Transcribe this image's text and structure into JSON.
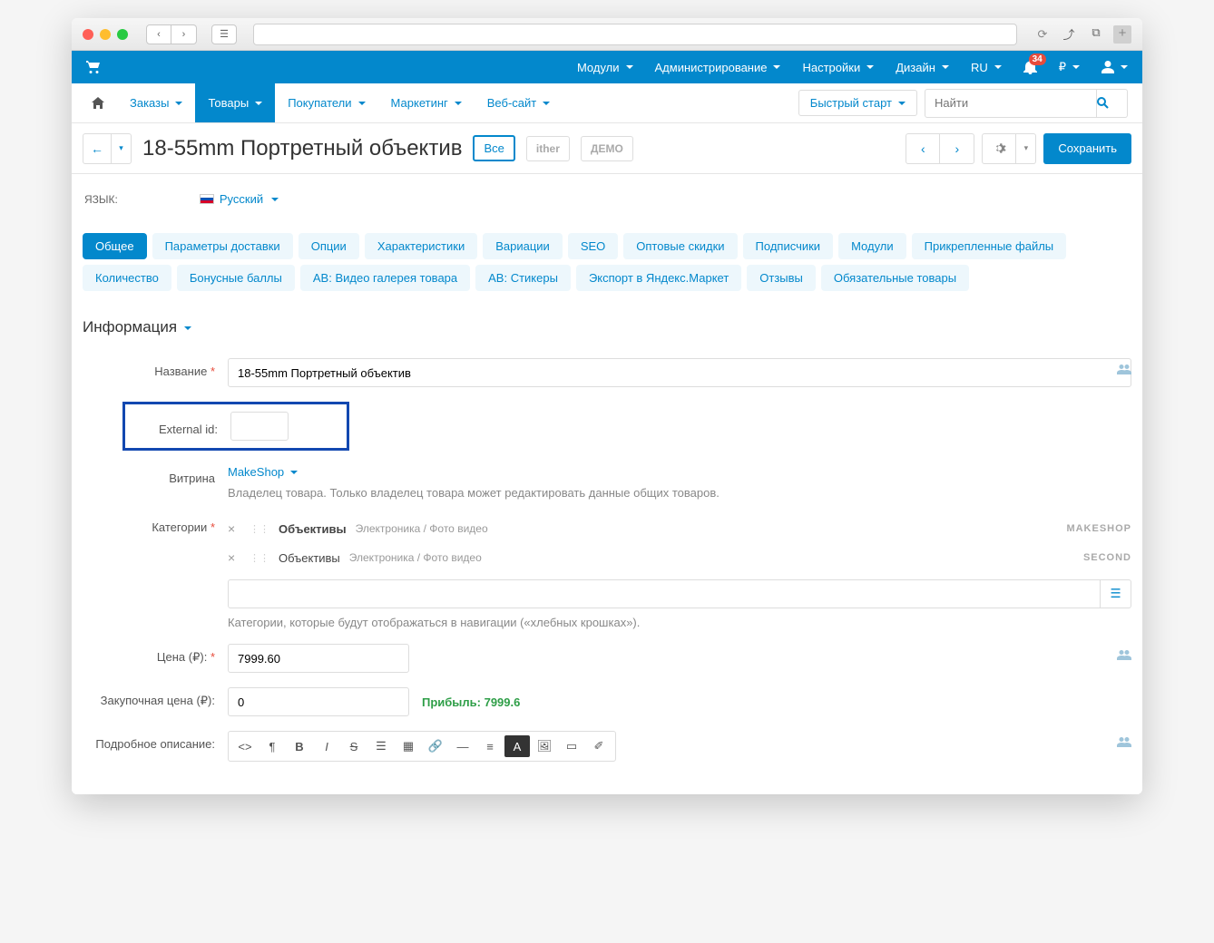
{
  "topbar": {
    "items": [
      "Модули",
      "Администрирование",
      "Настройки",
      "Дизайн"
    ],
    "lang": "RU",
    "notifications": "34",
    "currency": "₽"
  },
  "menubar": {
    "items": [
      "Заказы",
      "Товары",
      "Покупатели",
      "Маркетинг",
      "Веб-сайт"
    ],
    "activeIndex": 1,
    "quickstart": "Быстрый старт",
    "searchPlaceholder": "Найти"
  },
  "page": {
    "title": "18-55mm Портретный объектив",
    "storeAll": "Все",
    "storeWatermark": "ither",
    "storeDemo": "ДЕМО",
    "save": "Сохранить"
  },
  "lang": {
    "label": "ЯЗЫК:",
    "value": "Русский"
  },
  "tabs": [
    "Общее",
    "Параметры доставки",
    "Опции",
    "Характеристики",
    "Вариации",
    "SEO",
    "Оптовые скидки",
    "Подписчики",
    "Модули",
    "Прикрепленные файлы",
    "Количество",
    "Бонусные баллы",
    "AB: Видео галерея товара",
    "AB: Стикеры",
    "Экспорт в Яндекс.Маркет",
    "Отзывы",
    "Обязательные товары"
  ],
  "section": "Информация",
  "form": {
    "nameLabel": "Название",
    "nameValue": "18-55mm Портретный объектив",
    "externalLabel": "External id:",
    "externalValue": "",
    "showcaseLabel": "Витрина",
    "showcaseValue": "MakeShop",
    "showcaseHelp": "Владелец товара. Только владелец товара может редактировать данные общих товаров.",
    "categoriesLabel": "Категории",
    "categories": [
      {
        "name": "Объективы",
        "path": "Электроника / Фото видео",
        "store": "MAKESHOP",
        "bold": true
      },
      {
        "name": "Объективы",
        "path": "Электроника / Фото видео",
        "store": "SECOND",
        "bold": false
      }
    ],
    "categoriesHelp": "Категории, которые будут отображаться в навигации («хлебных крошках»).",
    "priceLabel": "Цена (₽):",
    "priceValue": "7999.60",
    "listPriceLabel": "Закупочная цена (₽):",
    "listPriceValue": "0",
    "profit": "Прибыль: 7999.6",
    "descLabel": "Подробное описание:"
  }
}
